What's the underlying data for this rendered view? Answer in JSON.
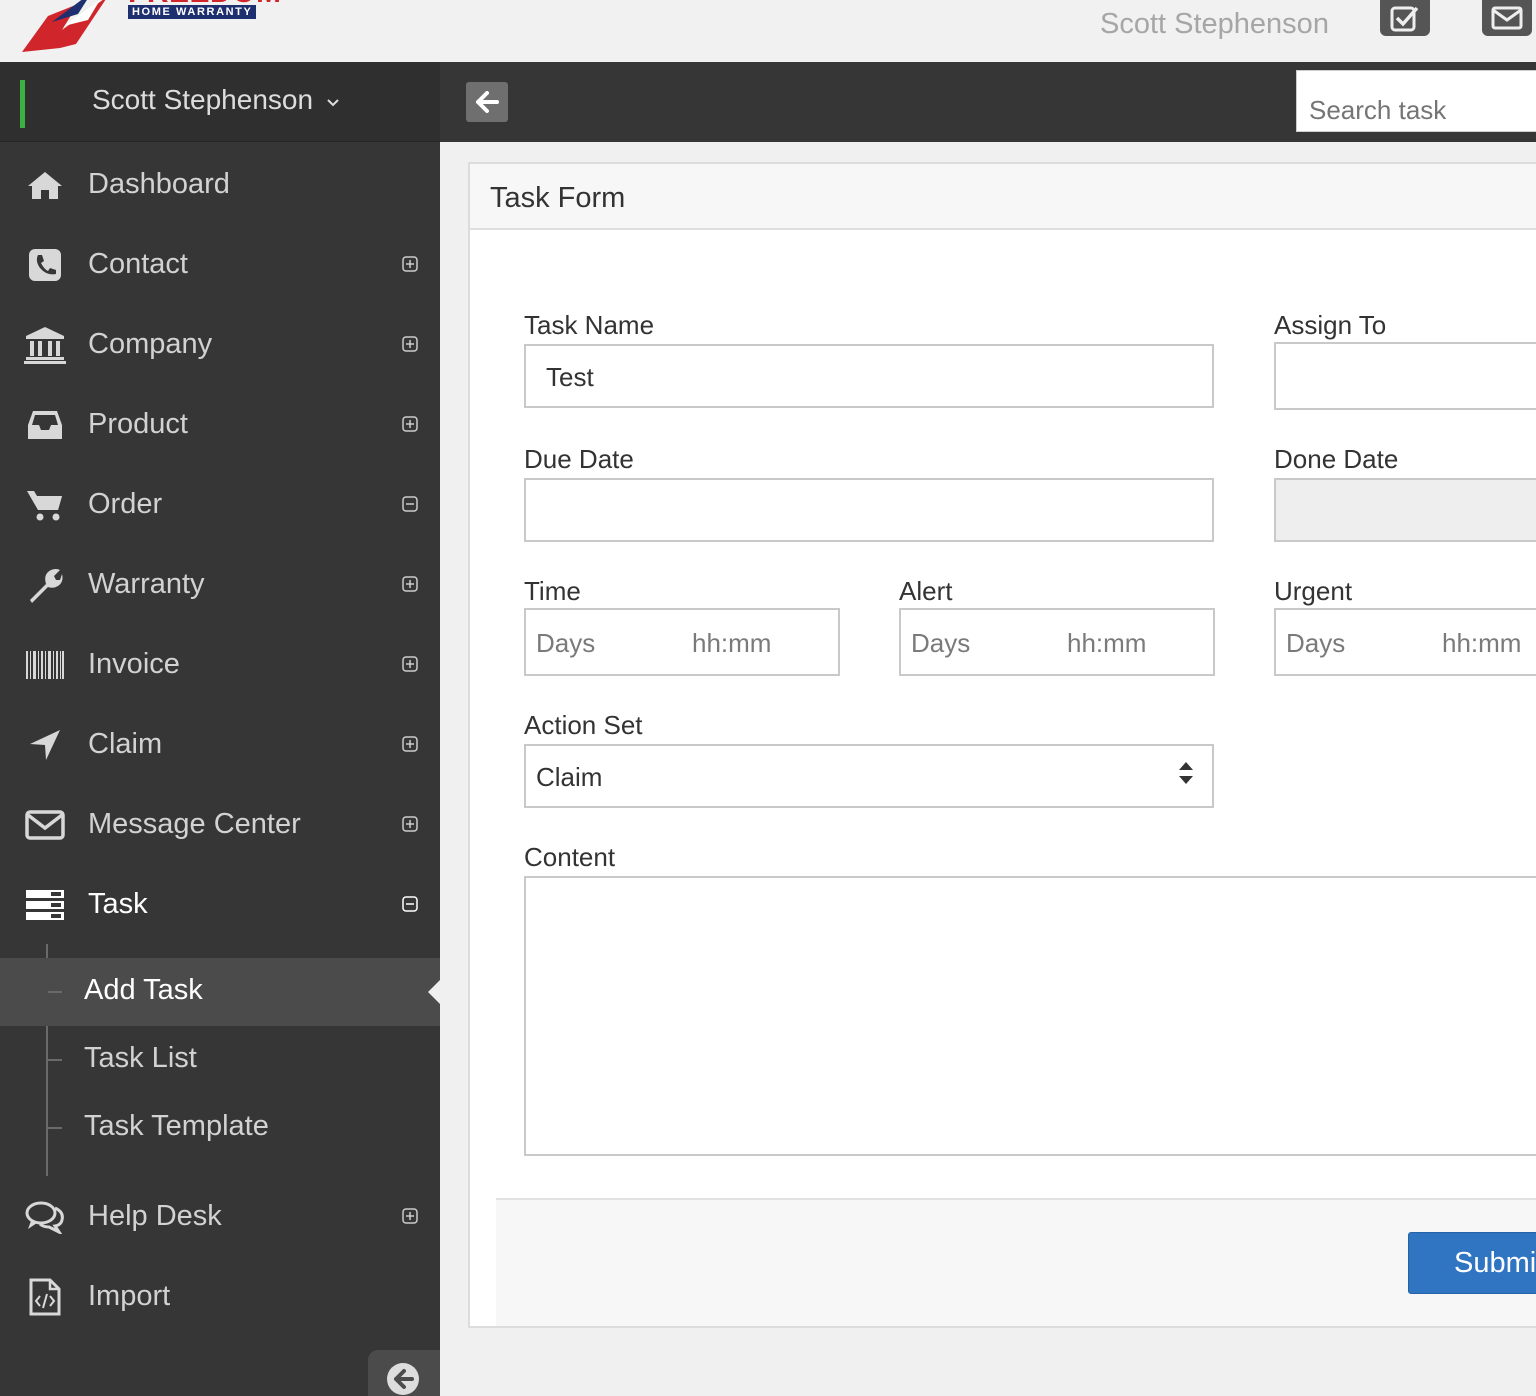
{
  "header": {
    "logo_text": "FREEDOM",
    "logo_subtext": "HOME WARRANTY",
    "user_name": "Scott Stephenson",
    "icons": [
      "checkbox-icon",
      "envelope-icon"
    ]
  },
  "navbar": {
    "user_name": "Scott Stephenson",
    "search_placeholder": "Search task"
  },
  "sidebar": {
    "items": [
      {
        "label": "Dashboard",
        "icon": "home-icon"
      },
      {
        "label": "Contact",
        "icon": "phone-icon"
      },
      {
        "label": "Company",
        "icon": "bank-icon"
      },
      {
        "label": "Product",
        "icon": "inbox-icon"
      },
      {
        "label": "Order",
        "icon": "cart-icon"
      },
      {
        "label": "Warranty",
        "icon": "wrench-icon"
      },
      {
        "label": "Invoice",
        "icon": "barcode-icon"
      },
      {
        "label": "Claim",
        "icon": "location-arrow-icon"
      },
      {
        "label": "Message Center",
        "icon": "envelope-icon"
      },
      {
        "label": "Task",
        "icon": "tasks-icon"
      },
      {
        "label": "Help Desk",
        "icon": "chat-icon"
      },
      {
        "label": "Import",
        "icon": "code-file-icon"
      }
    ],
    "task_children": [
      {
        "label": "Add Task"
      },
      {
        "label": "Task List"
      },
      {
        "label": "Task Template"
      }
    ]
  },
  "form": {
    "title": "Task Form",
    "task_name_label": "Task Name",
    "task_name_value": "Test",
    "assign_to_label": "Assign To",
    "due_date_label": "Due Date",
    "done_date_label": "Done Date",
    "time_label": "Time",
    "alert_label": "Alert",
    "urgent_label": "Urgent",
    "days_placeholder": "Days",
    "hhmm_placeholder": "hh:mm",
    "action_set_label": "Action Set",
    "action_set_value": "Claim",
    "content_label": "Content",
    "submit_label": "Submit"
  },
  "colors": {
    "sidebar_bg": "#363636",
    "accent_green": "#3cb043",
    "submit_blue": "#2f75c2",
    "logo_red": "#d0252b",
    "logo_navy": "#1d2f6f"
  }
}
